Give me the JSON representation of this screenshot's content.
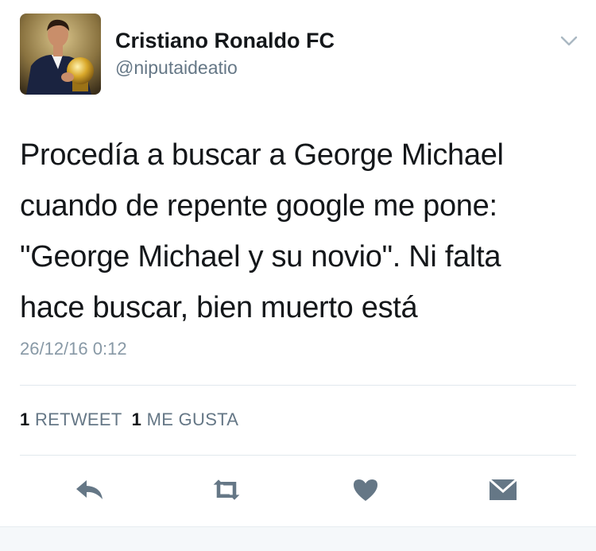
{
  "author": {
    "name": "Cristiano Ronaldo FC",
    "handle": "@niputaideatio"
  },
  "tweet": {
    "lines": [
      "Procedía a buscar a George Michael",
      "cuando de repente google me pone:",
      "\"George Michael y su novio\". Ni falta",
      "hace buscar, bien muerto está"
    ],
    "timestamp": "26/12/16 0:12"
  },
  "stats": {
    "retweets_count": "1",
    "retweets_label": "RETWEET",
    "likes_count": "1",
    "likes_label": "ME GUSTA"
  },
  "actions": {
    "icons": [
      "reply-icon",
      "retweet-icon",
      "heart-icon",
      "direct-message-icon"
    ]
  },
  "colors": {
    "text_primary": "#14171a",
    "text_secondary": "#657786",
    "timestamp": "#8899a6",
    "icon_gray": "#657786",
    "divider": "#e1e8ed"
  }
}
